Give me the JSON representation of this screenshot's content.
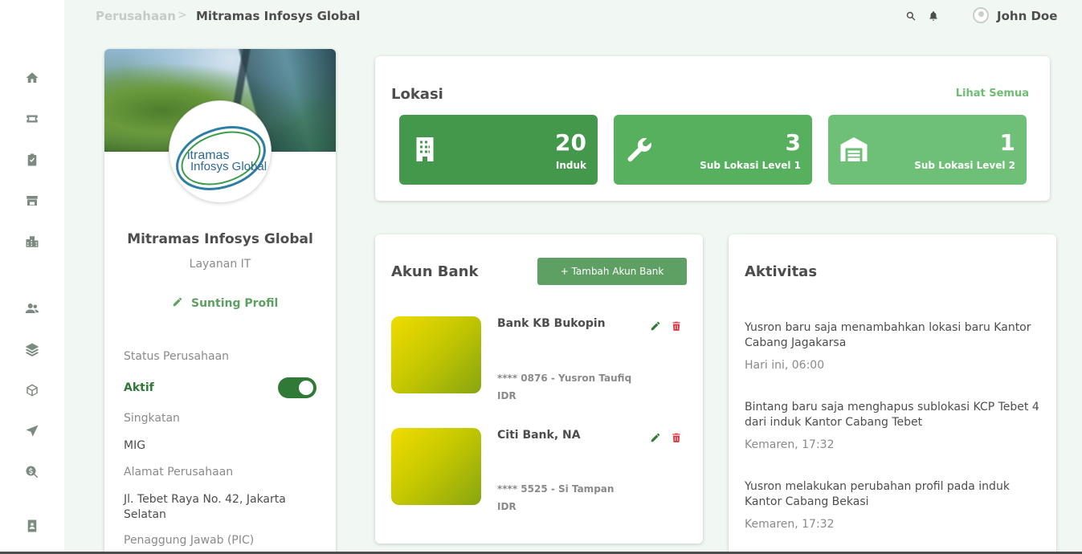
{
  "breadcrumb": {
    "parent": "Perusahaan",
    "separator": ">",
    "current": "Mitramas Infosys Global"
  },
  "user": {
    "name": "John Doe"
  },
  "sidebar_icons": [
    "home-icon",
    "ticket-icon",
    "clipboard-check-icon",
    "store-icon",
    "buildings-icon",
    "users-icon",
    "layers-icon",
    "cube-icon",
    "send-icon",
    "search-dollar-icon",
    "contact-book-icon"
  ],
  "profile": {
    "logo_text_line1": "itramas",
    "logo_text_line2": "Infosys Global",
    "name": "Mitramas Infosys Global",
    "type": "Layanan IT",
    "edit_label": "Sunting Profil",
    "status_label": "Status Perusahaan",
    "status_value": "Aktif",
    "status_on": true,
    "abbr_label": "Singkatan",
    "abbr_value": "MIG",
    "address_label": "Alamat Perusahaan",
    "address_value": "Jl. Tebet Raya No. 42, Jakarta Selatan",
    "pic_label": "Penaggung Jawab (PIC)"
  },
  "locations": {
    "title": "Lokasi",
    "see_all": "Lihat Semua",
    "stats": [
      {
        "value": "20",
        "label": "Induk",
        "icon": "building-icon",
        "color": "#43984b"
      },
      {
        "value": "3",
        "label": "Sub Lokasi Level 1",
        "icon": "wrench-icon",
        "color": "#56b05e"
      },
      {
        "value": "1",
        "label": "Sub Lokasi Level 2",
        "icon": "warehouse-icon",
        "color": "#6ec076"
      }
    ]
  },
  "banks": {
    "title": "Akun Bank",
    "add_label": "+ Tambah Akun Bank",
    "items": [
      {
        "name": "Bank KB Bukopin",
        "account": "**** 0876 - Yusron Taufiq",
        "currency": "IDR"
      },
      {
        "name": "Citi Bank, NA",
        "account": "**** 5525 - Si Tampan",
        "currency": "IDR"
      }
    ]
  },
  "activity": {
    "title": "Aktivitas",
    "items": [
      {
        "text": "Yusron baru saja menambahkan lokasi baru Kantor Cabang Jagakarsa",
        "time": "Hari ini, 06:00"
      },
      {
        "text": "Bintang baru saja menghapus sublokasi KCP Tebet 4 dari induk Kantor Cabang Tebet",
        "time": "Kemaren, 17:32"
      },
      {
        "text": "Yusron melakukan perubahan profil pada induk Kantor Cabang Bekasi",
        "time": "Kemaren, 17:32"
      }
    ]
  },
  "colors": {
    "primary": "#2f7a36",
    "accent": "#5e9f64",
    "link": "#6dbe72",
    "danger": "#d9363e"
  }
}
